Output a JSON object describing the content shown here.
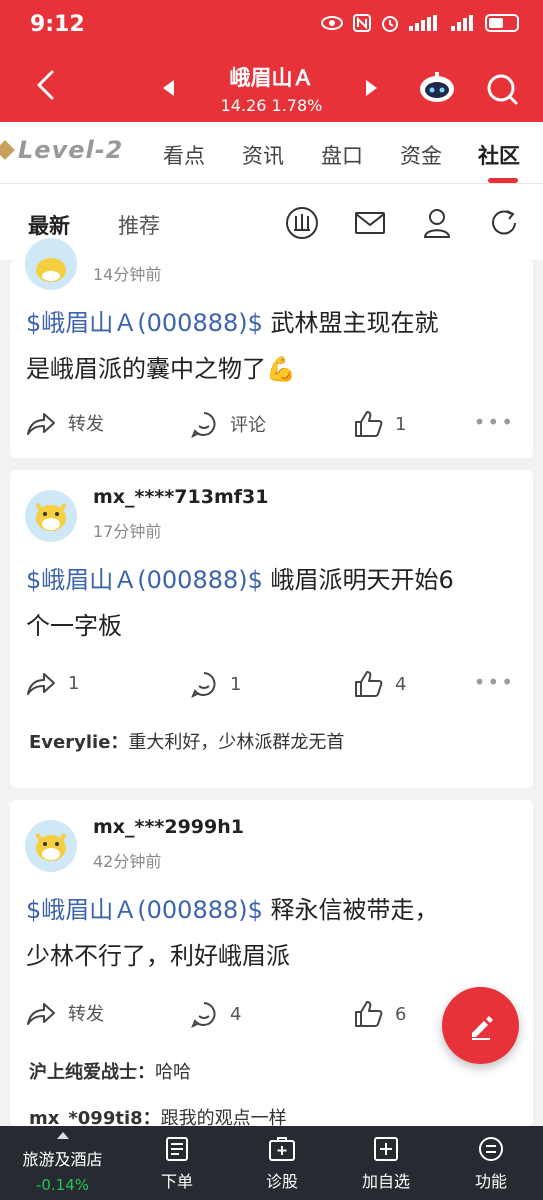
{
  "status_bar": {
    "time": "9:12"
  },
  "header": {
    "stock_name": "峨眉山Ａ",
    "price": "14.26",
    "change_pct": "1.78%"
  },
  "tabs": {
    "level2": "Level-2",
    "items": [
      "看点",
      "资讯",
      "盘口",
      "资金",
      "社区"
    ],
    "active": "社区"
  },
  "subtabs": {
    "items": [
      "最新",
      "推荐"
    ],
    "active": "最新"
  },
  "posts": [
    {
      "time": "14分钟前",
      "stock_tag": "$峨眉山Ａ(000888)$",
      "text_line1": " 武林盟主现在就",
      "text_line2": "是峨眉派的囊中之物了💪",
      "share": "转发",
      "comment": "评论",
      "likes": "1"
    },
    {
      "username": "mx_****713mf31",
      "time": "17分钟前",
      "stock_tag": "$峨眉山Ａ(000888)$",
      "text_line1": " 峨眉派明天开始6",
      "text_line2": "个一字板",
      "share": "1",
      "comment": "1",
      "likes": "4",
      "replies": [
        {
          "user": "Everylie：",
          "text": "重大利好，少林派群龙无首"
        }
      ]
    },
    {
      "username": "mx_***2999h1",
      "time": "42分钟前",
      "stock_tag": "$峨眉山Ａ(000888)$",
      "text_line1": " 释永信被带走，",
      "text_line2": "少林不行了，利好峨眉派",
      "share": "转发",
      "comment": "4",
      "likes": "6",
      "replies": [
        {
          "user": "沪上纯爱战士：",
          "text": "哈哈"
        },
        {
          "user": "mx_*099ti8：",
          "text": "跟我的观点一样"
        }
      ]
    }
  ],
  "bottom_bar": {
    "index_name": "旅游及酒店",
    "index_change": "-0.14%",
    "items": [
      "下单",
      "诊股",
      "加自选",
      "功能"
    ]
  },
  "colors": {
    "brand_red": "#e8323a",
    "link_blue": "#3c63b0",
    "down_green": "#25c55a",
    "bottom_bar_bg": "#262a31"
  }
}
